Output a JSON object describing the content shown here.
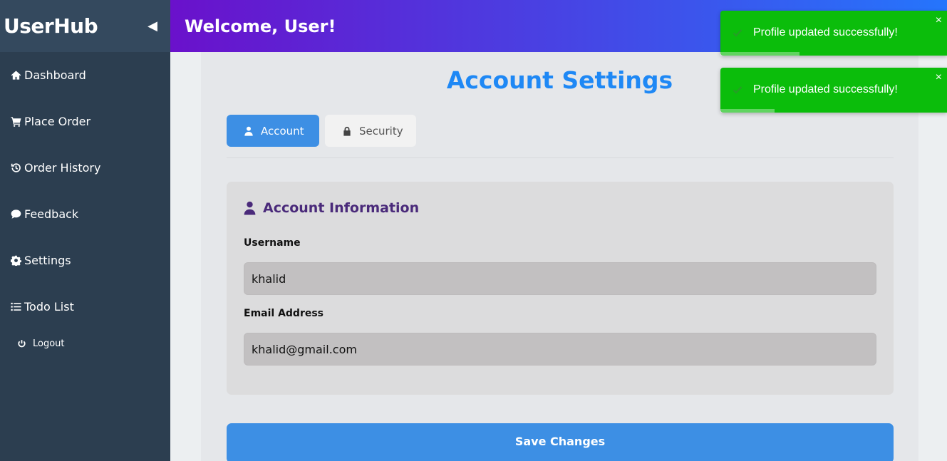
{
  "sidebar": {
    "brand": "UserHub",
    "collapse_icon": "◀",
    "items": [
      {
        "label": "Dashboard",
        "icon": "home-icon"
      },
      {
        "label": "Place Order",
        "icon": "cart-icon"
      },
      {
        "label": "Order History",
        "icon": "history-icon"
      },
      {
        "label": "Feedback",
        "icon": "comment-icon"
      },
      {
        "label": "Settings",
        "icon": "gear-icon"
      },
      {
        "label": "Todo List",
        "icon": "list-icon"
      }
    ],
    "logout_label": "Logout"
  },
  "header": {
    "title": "Welcome, User!"
  },
  "main": {
    "title": "Account Settings",
    "tabs": [
      {
        "label": "Account",
        "icon": "user-icon",
        "active": true
      },
      {
        "label": "Security",
        "icon": "lock-icon",
        "active": false
      }
    ],
    "panel": {
      "title": "Account Information",
      "username_label": "Username",
      "username_value": "khalid",
      "email_label": "Email Address",
      "email_value": "khalid@gmail.com"
    },
    "save_label": "Save Changes"
  },
  "toasts": [
    {
      "message": "Profile updated successfully!",
      "close": "×",
      "progress": 0.35
    },
    {
      "message": "Profile updated successfully!",
      "close": "×",
      "progress": 0.24
    }
  ],
  "colors": {
    "sidebar_bg": "#2c3e50",
    "header_gradient_start": "#6a11cb",
    "header_gradient_end": "#2575fc",
    "accent": "#3d8fe4",
    "toast_success": "#0bbd0b",
    "panel_title": "#4a2a7a"
  }
}
